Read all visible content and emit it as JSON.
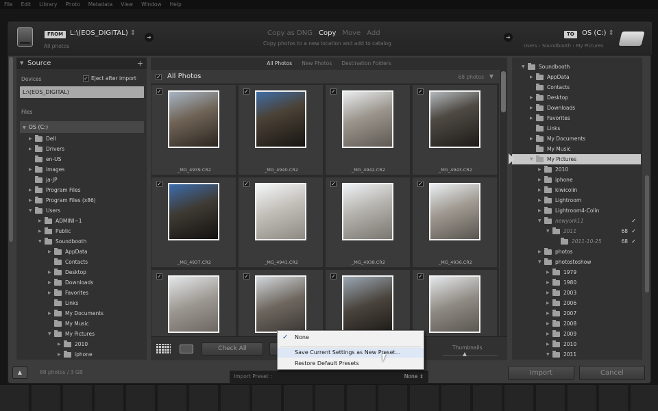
{
  "menubar": [
    "File",
    "Edit",
    "Library",
    "Photo",
    "Metadata",
    "View",
    "Window",
    "Help"
  ],
  "header": {
    "from_tag": "FROM",
    "source_name": "L:\\(EOS_DIGITAL)",
    "source_sub": "All photos",
    "modes": [
      {
        "label": "Copy as DNG",
        "active": false
      },
      {
        "label": "Copy",
        "active": true
      },
      {
        "label": "Move",
        "active": false
      },
      {
        "label": "Add",
        "active": false
      }
    ],
    "mode_desc": "Copy photos to a new location and add to catalog",
    "to_tag": "TO",
    "dest_name": "OS (C:)",
    "dest_sub": "Users › Soundbooth › My Pictures"
  },
  "source_panel": {
    "title": "Source",
    "devices_label": "Devices",
    "eject_label": "Eject after import",
    "device": "L:\\(EOS_DIGITAL)",
    "files_label": "Files",
    "drive": "OS (C:)",
    "tree": [
      {
        "label": "Dell",
        "indent": 0,
        "exp": "▶"
      },
      {
        "label": "Drivers",
        "indent": 0,
        "exp": "▶"
      },
      {
        "label": "en-US",
        "indent": 0,
        "exp": ""
      },
      {
        "label": "images",
        "indent": 0,
        "exp": "▶"
      },
      {
        "label": "ja-JP",
        "indent": 0,
        "exp": ""
      },
      {
        "label": "Program Files",
        "indent": 0,
        "exp": "▶"
      },
      {
        "label": "Program Files (x86)",
        "indent": 0,
        "exp": "▶"
      },
      {
        "label": "Users",
        "indent": 0,
        "exp": "▼"
      },
      {
        "label": "ADMINI~1",
        "indent": 1,
        "exp": "▶"
      },
      {
        "label": "Public",
        "indent": 1,
        "exp": "▶"
      },
      {
        "label": "Soundbooth",
        "indent": 1,
        "exp": "▼"
      },
      {
        "label": "AppData",
        "indent": 2,
        "exp": "▶"
      },
      {
        "label": "Contacts",
        "indent": 2,
        "exp": ""
      },
      {
        "label": "Desktop",
        "indent": 2,
        "exp": "▶"
      },
      {
        "label": "Downloads",
        "indent": 2,
        "exp": "▶"
      },
      {
        "label": "Favorites",
        "indent": 2,
        "exp": "▶"
      },
      {
        "label": "Links",
        "indent": 2,
        "exp": ""
      },
      {
        "label": "My Documents",
        "indent": 2,
        "exp": "▶"
      },
      {
        "label": "My Music",
        "indent": 2,
        "exp": ""
      },
      {
        "label": "My Pictures",
        "indent": 2,
        "exp": "▼"
      },
      {
        "label": "2010",
        "indent": 3,
        "exp": "▶"
      },
      {
        "label": "iphone",
        "indent": 3,
        "exp": "▶"
      }
    ]
  },
  "grid": {
    "tabs": [
      {
        "label": "All Photos",
        "active": true
      },
      {
        "label": "New Photos",
        "active": false
      },
      {
        "label": "Destination Folders",
        "active": false
      }
    ],
    "header_title": "All Photos",
    "count": "68 photos",
    "photos": [
      {
        "name": "_MG_4939.CR2",
        "tone": "t1"
      },
      {
        "name": "_MG_4940.CR2",
        "tone": "t2"
      },
      {
        "name": "_MG_4942.CR2",
        "tone": "t3"
      },
      {
        "name": "_MG_4943.CR2",
        "tone": "t4"
      },
      {
        "name": "_MG_4937.CR2",
        "tone": "t5"
      },
      {
        "name": "_MG_4941.CR2",
        "tone": "t6"
      },
      {
        "name": "_MG_4938.CR2",
        "tone": "t7"
      },
      {
        "name": "_MG_4936.CR2",
        "tone": "t8"
      },
      {
        "name": "",
        "tone": "t9"
      },
      {
        "name": "",
        "tone": "t10"
      },
      {
        "name": "",
        "tone": "t11"
      },
      {
        "name": "",
        "tone": "t12"
      }
    ]
  },
  "toolbar": {
    "check_all": "Check All",
    "thumbnails_label": "Thumbnails"
  },
  "dest_panel": {
    "tree": [
      {
        "label": "Soundbooth",
        "indent": 0,
        "exp": "▼",
        "sel": false,
        "dim": false
      },
      {
        "label": "AppData",
        "indent": 1,
        "exp": "▶",
        "sel": false,
        "dim": false
      },
      {
        "label": "Contacts",
        "indent": 1,
        "exp": "",
        "sel": false,
        "dim": false
      },
      {
        "label": "Desktop",
        "indent": 1,
        "exp": "▶",
        "sel": false,
        "dim": false
      },
      {
        "label": "Downloads",
        "indent": 1,
        "exp": "▶",
        "sel": false,
        "dim": false
      },
      {
        "label": "Favorites",
        "indent": 1,
        "exp": "▶",
        "sel": false,
        "dim": false
      },
      {
        "label": "Links",
        "indent": 1,
        "exp": "",
        "sel": false,
        "dim": false
      },
      {
        "label": "My Documents",
        "indent": 1,
        "exp": "▶",
        "sel": false,
        "dim": false
      },
      {
        "label": "My Music",
        "indent": 1,
        "exp": "",
        "sel": false,
        "dim": false
      },
      {
        "label": "My Pictures",
        "indent": 1,
        "exp": "▼",
        "sel": true,
        "dim": false
      },
      {
        "label": "2010",
        "indent": 2,
        "exp": "▶",
        "sel": false,
        "dim": false
      },
      {
        "label": "iphone",
        "indent": 2,
        "exp": "▶",
        "sel": false,
        "dim": false
      },
      {
        "label": "kiwicolin",
        "indent": 2,
        "exp": "▶",
        "sel": false,
        "dim": false
      },
      {
        "label": "Lightroom",
        "indent": 2,
        "exp": "▶",
        "sel": false,
        "dim": false
      },
      {
        "label": "Lightroom4-Colin",
        "indent": 2,
        "exp": "▶",
        "sel": false,
        "dim": false
      },
      {
        "label": "newyork11",
        "indent": 2,
        "exp": "▼",
        "sel": false,
        "dim": true,
        "check": "✓"
      },
      {
        "label": "2011",
        "indent": 3,
        "exp": "▼",
        "sel": false,
        "dim": true,
        "count": "68",
        "check": "✓"
      },
      {
        "label": "2011-10-25",
        "indent": 4,
        "exp": "",
        "sel": false,
        "dim": true,
        "count": "68",
        "check": "✓"
      },
      {
        "label": "photos",
        "indent": 2,
        "exp": "▶",
        "sel": false,
        "dim": false
      },
      {
        "label": "photostoshow",
        "indent": 2,
        "exp": "▼",
        "sel": false,
        "dim": false
      },
      {
        "label": "1979",
        "indent": 3,
        "exp": "▶",
        "sel": false,
        "dim": false
      },
      {
        "label": "1980",
        "indent": 3,
        "exp": "▶",
        "sel": false,
        "dim": false
      },
      {
        "label": "2003",
        "indent": 3,
        "exp": "▶",
        "sel": false,
        "dim": false
      },
      {
        "label": "2006",
        "indent": 3,
        "exp": "▶",
        "sel": false,
        "dim": false
      },
      {
        "label": "2007",
        "indent": 3,
        "exp": "▶",
        "sel": false,
        "dim": false
      },
      {
        "label": "2008",
        "indent": 3,
        "exp": "▶",
        "sel": false,
        "dim": false
      },
      {
        "label": "2009",
        "indent": 3,
        "exp": "▶",
        "sel": false,
        "dim": false
      },
      {
        "label": "2010",
        "indent": 3,
        "exp": "▶",
        "sel": false,
        "dim": false
      },
      {
        "label": "2011",
        "indent": 3,
        "exp": "▼",
        "sel": false,
        "dim": false
      }
    ]
  },
  "footer": {
    "count": "68 photos / 3 GB",
    "preset_label": "Import Preset :",
    "preset_value": "None ⇕",
    "import": "Import",
    "cancel": "Cancel"
  },
  "preset_menu": {
    "items": [
      "None",
      "Save Current Settings as New Preset...",
      "Restore Default Presets"
    ],
    "checked_index": 0,
    "check_mark": "✓"
  }
}
